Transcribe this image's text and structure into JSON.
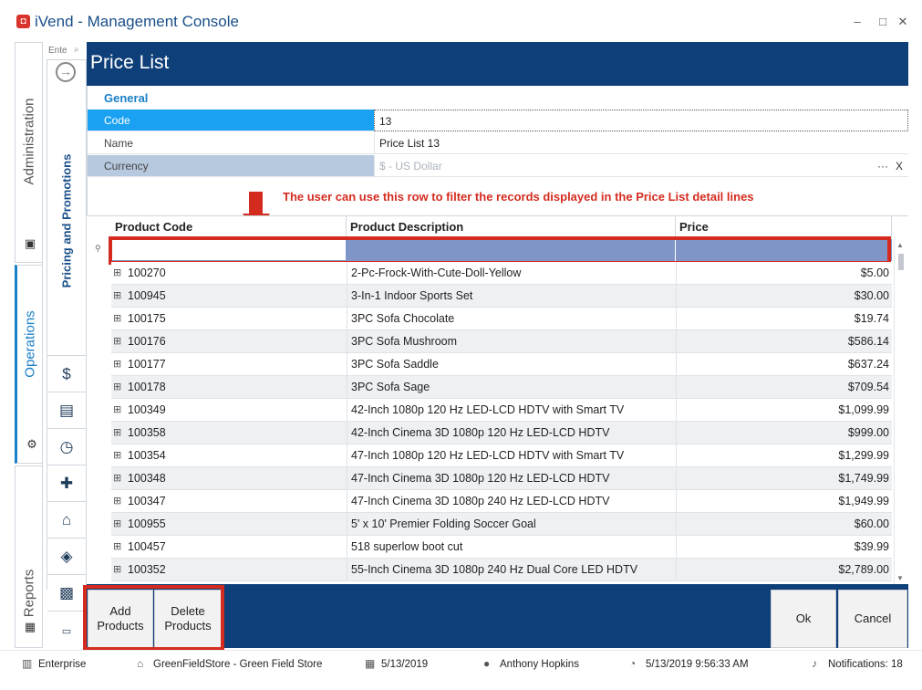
{
  "window": {
    "title": "iVend - Management Console",
    "minimize": "–",
    "maximize": "□",
    "close": "✕"
  },
  "modules": {
    "administration": "Administration",
    "operations": "Operations",
    "reports": "Reports"
  },
  "nav": {
    "search_placeholder": "Ente",
    "section_title": "Pricing and Promotions"
  },
  "page": {
    "title": "Price List"
  },
  "general": {
    "title": "General",
    "code_label": "Code",
    "code_value": "13",
    "name_label": "Name",
    "name_value": "Price List 13",
    "currency_label": "Currency",
    "currency_placeholder": "$ - US Dollar",
    "currency_more": "···",
    "currency_clear": "X"
  },
  "annotation": "The user can use this row to filter the records displayed in the Price List detail lines",
  "grid": {
    "columns": {
      "code": "Product Code",
      "description": "Product Description",
      "price": "Price"
    },
    "rows": [
      {
        "code": "100270",
        "description": "2-Pc-Frock-With-Cute-Doll-Yellow",
        "price": "$5.00"
      },
      {
        "code": "100945",
        "description": "3-In-1 Indoor Sports Set",
        "price": "$30.00"
      },
      {
        "code": "100175",
        "description": "3PC Sofa Chocolate",
        "price": "$19.74"
      },
      {
        "code": "100176",
        "description": "3PC Sofa Mushroom",
        "price": "$586.14"
      },
      {
        "code": "100177",
        "description": "3PC Sofa Saddle",
        "price": "$637.24"
      },
      {
        "code": "100178",
        "description": "3PC Sofa Sage",
        "price": "$709.54"
      },
      {
        "code": "100349",
        "description": "42-Inch 1080p 120 Hz LED-LCD HDTV with Smart TV",
        "price": "$1,099.99"
      },
      {
        "code": "100358",
        "description": "42-Inch Cinema 3D 1080p 120 Hz LED-LCD HDTV",
        "price": "$999.00"
      },
      {
        "code": "100354",
        "description": "47-Inch 1080p 120 Hz LED-LCD HDTV with Smart TV",
        "price": "$1,299.99"
      },
      {
        "code": "100348",
        "description": "47-Inch Cinema 3D 1080p 120 Hz LED-LCD HDTV",
        "price": "$1,749.99"
      },
      {
        "code": "100347",
        "description": "47-Inch Cinema 3D 1080p 240 Hz LED-LCD HDTV",
        "price": "$1,949.99"
      },
      {
        "code": "100955",
        "description": "5' x 10' Premier Folding Soccer Goal",
        "price": "$60.00"
      },
      {
        "code": "100457",
        "description": "518 superlow boot cut",
        "price": "$39.99"
      },
      {
        "code": "100352",
        "description": "55-Inch Cinema 3D 1080p 240 Hz Dual Core LED HDTV",
        "price": "$2,789.00"
      }
    ]
  },
  "actions": {
    "add_products": "Add Products",
    "delete_products": "Delete Products",
    "ok": "Ok",
    "cancel": "Cancel"
  },
  "status": {
    "enterprise": "Enterprise",
    "store": "GreenFieldStore - Green Field Store",
    "date": "5/13/2019",
    "user": "Anthony Hopkins",
    "datetime": "5/13/2019 9:56:33 AM",
    "notifications": "Notifications: 18"
  },
  "colors": {
    "header_blue": "#0e3f78",
    "accent_blue": "#1a80c8",
    "selected_field": "#1ba1f2",
    "filter_row": "#7f95c8",
    "annotation_red": "#d42b1f"
  }
}
